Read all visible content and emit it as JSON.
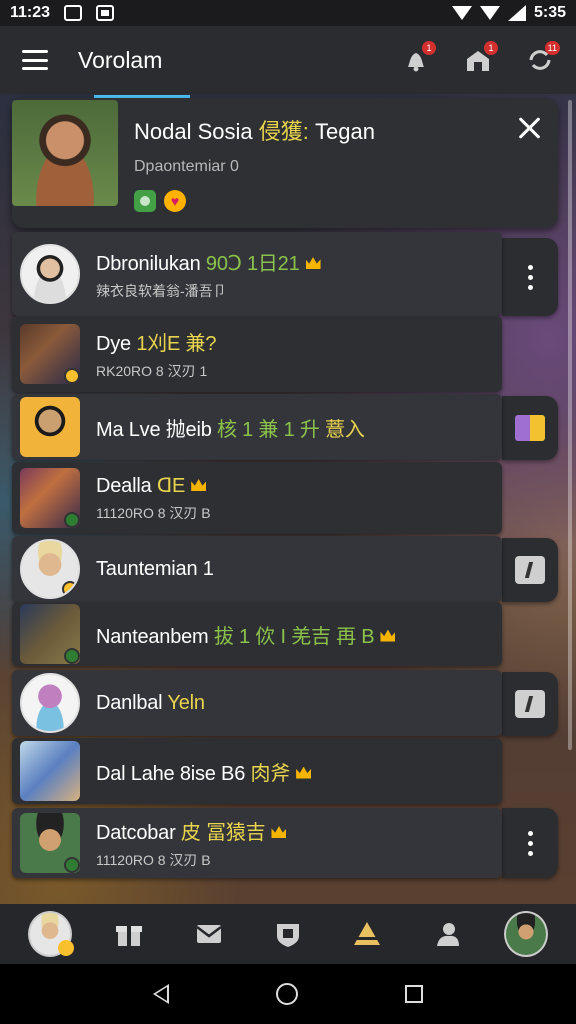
{
  "status_bar": {
    "time_left": "11:23",
    "time_right": "5:35"
  },
  "app_bar": {
    "title": "Vorolam",
    "icons": [
      "bell-icon",
      "shop-icon",
      "refresh-icon"
    ],
    "badges": [
      "1",
      "1",
      "11"
    ]
  },
  "featured": {
    "name_prefix": "Nodal Sosia ",
    "name_highlight": "侵獲:",
    "name_suffix": " Tegan",
    "subtitle": "Dpaontemiar 0",
    "tags": [
      "green-tag",
      "heart-tag"
    ],
    "heart_glyph": "♥"
  },
  "rows": [
    {
      "title": "Dbronilukan ",
      "title_green": "90Ↄ 1日21",
      "crown": true,
      "sub": "辣衣良软着翁-潘吾卩"
    },
    {
      "title": "Dye ",
      "title_yellow": "1刈E 兼?",
      "crown": false,
      "sub": "RK20RO 8 汉刃 1"
    },
    {
      "title": "Ma Lve 抛eib ",
      "title_green": "核 1 兼 1 升",
      "title_yellow": " 薏入",
      "crown": false,
      "sub": ""
    },
    {
      "title": "Dealla ",
      "title_yellow": "ꓷE",
      "crown": true,
      "sub": "11120RO 8 汉刃 B"
    },
    {
      "title": "Tauntemian 1",
      "crown": false,
      "sub": ""
    },
    {
      "title": "Nanteanbem ",
      "title_green": "拔 1 佽 I 羌吉  再 B",
      "crown": true,
      "sub": ""
    },
    {
      "title": "Danlbal ",
      "title_yellow": "Yeln",
      "crown": false,
      "sub": ""
    },
    {
      "title": "Dal Lahe 8ise B6 ",
      "title_yellow": "肉斧",
      "crown": true,
      "sub": ""
    },
    {
      "title": "Datcobar ",
      "title_yellow": "皮 冨猿吉",
      "crown": true,
      "sub": "11120RO 8 汉刃 B"
    }
  ],
  "bottom_nav": [
    "profile-avatar",
    "gift-icon",
    "mail-icon",
    "shield-icon",
    "tent-icon",
    "friend-icon",
    "account-avatar"
  ]
}
